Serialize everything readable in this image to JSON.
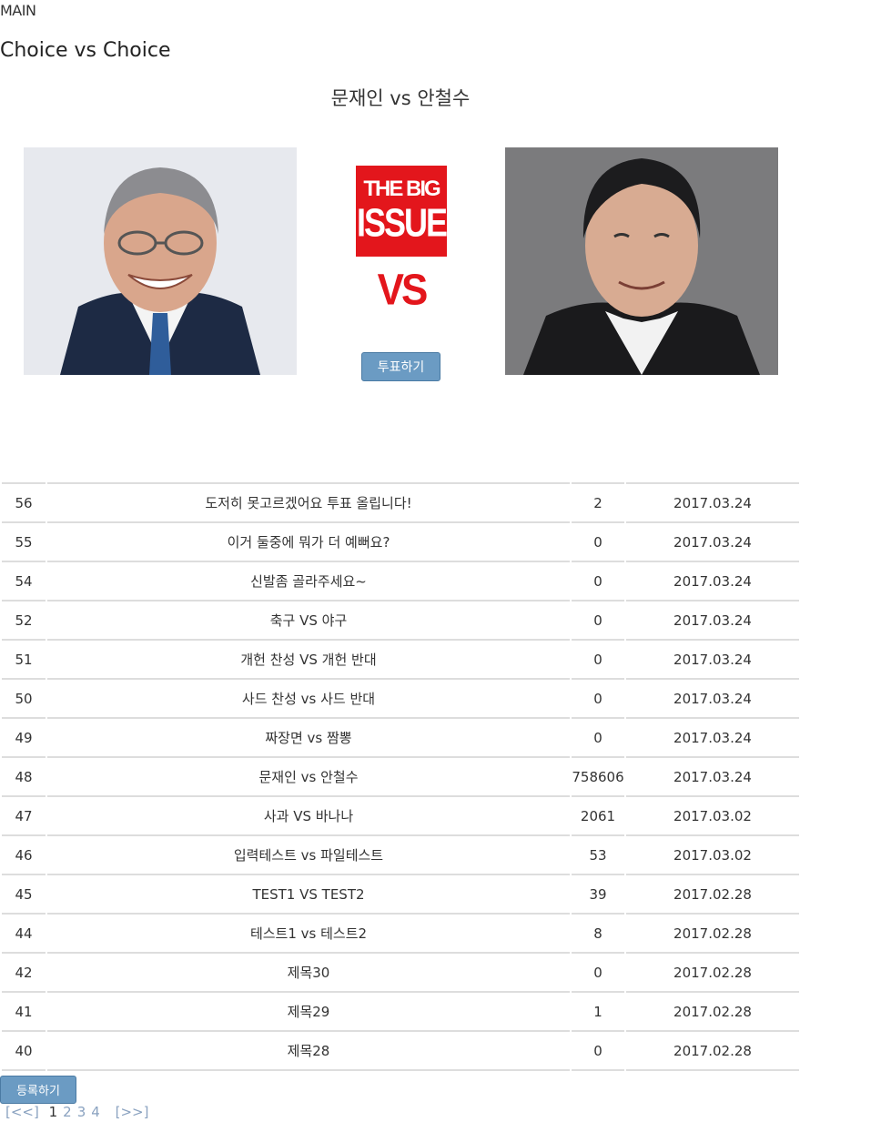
{
  "nav": {
    "main_link": "MAIN"
  },
  "site_title": "Choice vs Choice",
  "matchup": {
    "title": "문재인 vs 안철수",
    "left_photo": "candidate-left-photo",
    "right_photo": "candidate-right-photo",
    "logo_line1": "THE BIG",
    "logo_line2": "ISSUE",
    "vs_label": "VS",
    "vote_button": "투표하기"
  },
  "colors": {
    "button": "#6b9bc3",
    "logo_red": "#e3161c",
    "row_border": "#dddddd",
    "pager_link": "#8aa2c0"
  },
  "posts": [
    {
      "num": "56",
      "title": "도저히 못고르겠어요 투표 올립니다!",
      "votes": "2",
      "date": "2017.03.24"
    },
    {
      "num": "55",
      "title": "이거 둘중에 뭐가 더 예뻐요?",
      "votes": "0",
      "date": "2017.03.24"
    },
    {
      "num": "54",
      "title": "신발좀 골라주세요~",
      "votes": "0",
      "date": "2017.03.24"
    },
    {
      "num": "52",
      "title": "축구 VS 야구",
      "votes": "0",
      "date": "2017.03.24"
    },
    {
      "num": "51",
      "title": "개헌 찬성 VS 개헌 반대",
      "votes": "0",
      "date": "2017.03.24"
    },
    {
      "num": "50",
      "title": "사드 찬성 vs 사드 반대",
      "votes": "0",
      "date": "2017.03.24"
    },
    {
      "num": "49",
      "title": "짜장면 vs 짬뽕",
      "votes": "0",
      "date": "2017.03.24"
    },
    {
      "num": "48",
      "title": "문재인 vs 안철수",
      "votes": "758606",
      "date": "2017.03.24"
    },
    {
      "num": "47",
      "title": "사과 VS 바나나",
      "votes": "2061",
      "date": "2017.03.02"
    },
    {
      "num": "46",
      "title": "입력테스트 vs 파일테스트",
      "votes": "53",
      "date": "2017.03.02"
    },
    {
      "num": "45",
      "title": "TEST1 VS TEST2",
      "votes": "39",
      "date": "2017.02.28"
    },
    {
      "num": "44",
      "title": "테스트1 vs 테스트2",
      "votes": "8",
      "date": "2017.02.28"
    },
    {
      "num": "42",
      "title": "제목30",
      "votes": "0",
      "date": "2017.02.28"
    },
    {
      "num": "41",
      "title": "제목29",
      "votes": "1",
      "date": "2017.02.28"
    },
    {
      "num": "40",
      "title": "제목28",
      "votes": "0",
      "date": "2017.02.28"
    }
  ],
  "register_button": "등록하기",
  "pagination": {
    "first": "[<<]",
    "pages": [
      "1",
      "2",
      "3",
      "4"
    ],
    "current": "1",
    "next": "[>>]"
  }
}
